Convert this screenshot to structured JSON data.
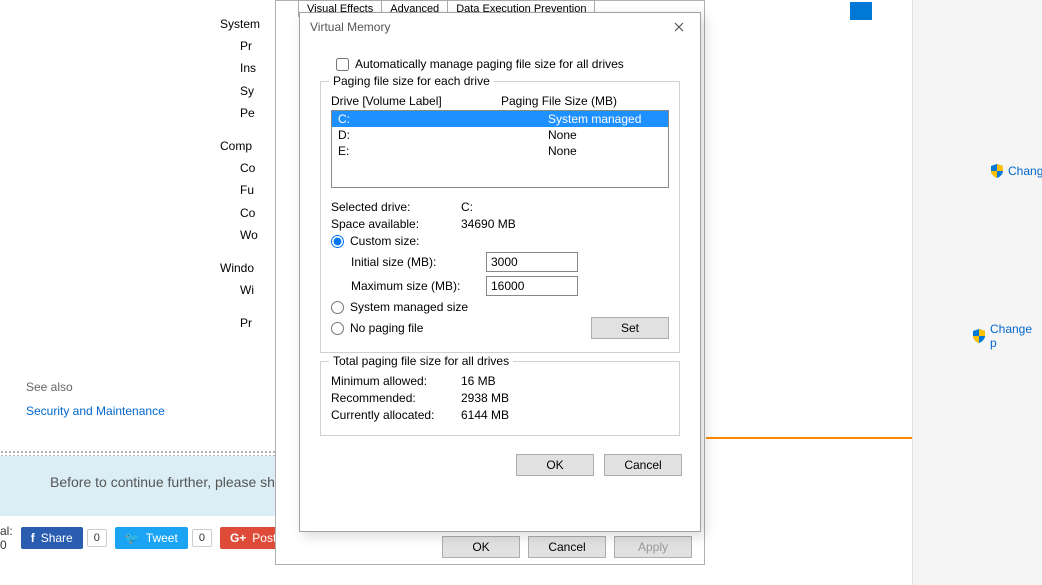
{
  "dialog": {
    "title": "Virtual Memory",
    "auto_manage_label": "Automatically manage paging file size for all drives",
    "auto_manage_checked": false,
    "group1_title": "Paging file size for each drive",
    "drive_header_left": "Drive  [Volume Label]",
    "drive_header_right": "Paging File Size (MB)",
    "drives": [
      {
        "letter": "C:",
        "size": "System managed",
        "selected": true
      },
      {
        "letter": "D:",
        "size": "None",
        "selected": false
      },
      {
        "letter": "E:",
        "size": "None",
        "selected": false
      }
    ],
    "selected_drive_label": "Selected drive:",
    "selected_drive_value": "C:",
    "space_available_label": "Space available:",
    "space_available_value": "34690 MB",
    "custom_size_label": "Custom size:",
    "initial_size_label": "Initial size (MB):",
    "initial_size_value": "3000",
    "maximum_size_label": "Maximum size (MB):",
    "maximum_size_value": "16000",
    "system_managed_label": "System managed size",
    "no_paging_label": "No paging file",
    "set_button": "Set",
    "group2_title": "Total paging file size for all drives",
    "minimum_allowed_label": "Minimum allowed:",
    "minimum_allowed_value": "16 MB",
    "recommended_label": "Recommended:",
    "recommended_value": "2938 MB",
    "currently_allocated_label": "Currently allocated:",
    "currently_allocated_value": "6144 MB",
    "ok_button": "OK",
    "cancel_button": "Cancel"
  },
  "parent_dialog": {
    "tabs": [
      "Visual Effects",
      "Advanced",
      "Data Execution Prevention"
    ],
    "ok_button": "OK",
    "cancel_button": "Cancel",
    "apply_button": "Apply"
  },
  "background": {
    "section1": "System",
    "items1": [
      "Pr",
      "Ins",
      "Sy",
      "Pe"
    ],
    "section2": "Comp",
    "items2": [
      "Co",
      "Fu",
      "Co",
      "Wo"
    ],
    "section3": "Windo",
    "items3": [
      "Wi",
      "Pr"
    ],
    "see_also": "See also",
    "security_link": "Security and Maintenance",
    "banner_text": "Before to continue further, please sh",
    "social_prefix": "al: 0",
    "share_label": "Share",
    "tweet_label": "Tweet",
    "post_label": "Post",
    "count_zero": "0"
  },
  "right": {
    "change_link1": "Chang",
    "change_link2": "Change p"
  }
}
